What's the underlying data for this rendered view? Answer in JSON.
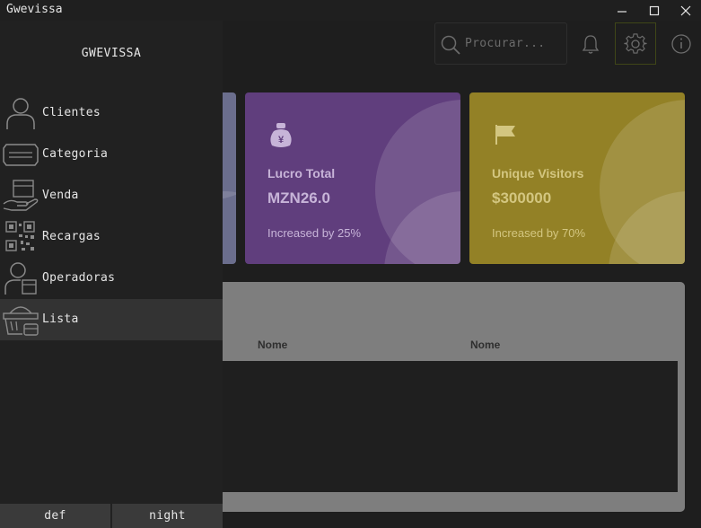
{
  "window": {
    "title": "Gwevissa"
  },
  "sidebar": {
    "brand": "GWEVISSA",
    "items": [
      {
        "label": "Clientes",
        "icon": "person-icon"
      },
      {
        "label": "Categoria",
        "icon": "card-stack-icon"
      },
      {
        "label": "Venda",
        "icon": "hand-box-icon"
      },
      {
        "label": "Recargas",
        "icon": "qr-code-icon"
      },
      {
        "label": "Operadoras",
        "icon": "person-package-icon"
      },
      {
        "label": "Lista",
        "icon": "basket-icon",
        "active": true
      }
    ],
    "theme_buttons": {
      "def": "def",
      "night": "night"
    }
  },
  "header": {
    "search": {
      "placeholder": "Procurar..."
    }
  },
  "cards": [
    {
      "title": "Lucro Total",
      "value": "MZN26.0",
      "subtitle": "Increased by 25%",
      "icon": "money-bag-icon",
      "color": "#603e7d"
    },
    {
      "title": "Unique Visitors",
      "value": "$300000",
      "subtitle": "Increased by 70%",
      "icon": "flag-icon",
      "color": "#938126"
    }
  ],
  "table": {
    "columns": [
      "Nome",
      "Nome"
    ]
  }
}
